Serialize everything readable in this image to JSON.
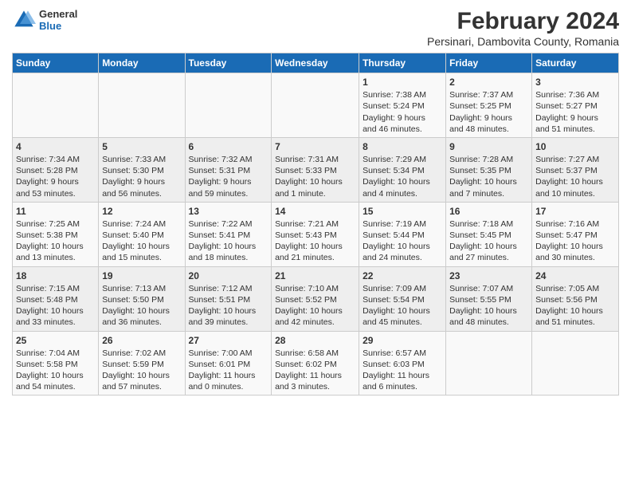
{
  "header": {
    "logo_general": "General",
    "logo_blue": "Blue",
    "month_year": "February 2024",
    "location": "Persinari, Dambovita County, Romania"
  },
  "days_of_week": [
    "Sunday",
    "Monday",
    "Tuesday",
    "Wednesday",
    "Thursday",
    "Friday",
    "Saturday"
  ],
  "weeks": [
    [
      {
        "day": "",
        "info": ""
      },
      {
        "day": "",
        "info": ""
      },
      {
        "day": "",
        "info": ""
      },
      {
        "day": "",
        "info": ""
      },
      {
        "day": "1",
        "info": "Sunrise: 7:38 AM\nSunset: 5:24 PM\nDaylight: 9 hours\nand 46 minutes."
      },
      {
        "day": "2",
        "info": "Sunrise: 7:37 AM\nSunset: 5:25 PM\nDaylight: 9 hours\nand 48 minutes."
      },
      {
        "day": "3",
        "info": "Sunrise: 7:36 AM\nSunset: 5:27 PM\nDaylight: 9 hours\nand 51 minutes."
      }
    ],
    [
      {
        "day": "4",
        "info": "Sunrise: 7:34 AM\nSunset: 5:28 PM\nDaylight: 9 hours\nand 53 minutes."
      },
      {
        "day": "5",
        "info": "Sunrise: 7:33 AM\nSunset: 5:30 PM\nDaylight: 9 hours\nand 56 minutes."
      },
      {
        "day": "6",
        "info": "Sunrise: 7:32 AM\nSunset: 5:31 PM\nDaylight: 9 hours\nand 59 minutes."
      },
      {
        "day": "7",
        "info": "Sunrise: 7:31 AM\nSunset: 5:33 PM\nDaylight: 10 hours\nand 1 minute."
      },
      {
        "day": "8",
        "info": "Sunrise: 7:29 AM\nSunset: 5:34 PM\nDaylight: 10 hours\nand 4 minutes."
      },
      {
        "day": "9",
        "info": "Sunrise: 7:28 AM\nSunset: 5:35 PM\nDaylight: 10 hours\nand 7 minutes."
      },
      {
        "day": "10",
        "info": "Sunrise: 7:27 AM\nSunset: 5:37 PM\nDaylight: 10 hours\nand 10 minutes."
      }
    ],
    [
      {
        "day": "11",
        "info": "Sunrise: 7:25 AM\nSunset: 5:38 PM\nDaylight: 10 hours\nand 13 minutes."
      },
      {
        "day": "12",
        "info": "Sunrise: 7:24 AM\nSunset: 5:40 PM\nDaylight: 10 hours\nand 15 minutes."
      },
      {
        "day": "13",
        "info": "Sunrise: 7:22 AM\nSunset: 5:41 PM\nDaylight: 10 hours\nand 18 minutes."
      },
      {
        "day": "14",
        "info": "Sunrise: 7:21 AM\nSunset: 5:43 PM\nDaylight: 10 hours\nand 21 minutes."
      },
      {
        "day": "15",
        "info": "Sunrise: 7:19 AM\nSunset: 5:44 PM\nDaylight: 10 hours\nand 24 minutes."
      },
      {
        "day": "16",
        "info": "Sunrise: 7:18 AM\nSunset: 5:45 PM\nDaylight: 10 hours\nand 27 minutes."
      },
      {
        "day": "17",
        "info": "Sunrise: 7:16 AM\nSunset: 5:47 PM\nDaylight: 10 hours\nand 30 minutes."
      }
    ],
    [
      {
        "day": "18",
        "info": "Sunrise: 7:15 AM\nSunset: 5:48 PM\nDaylight: 10 hours\nand 33 minutes."
      },
      {
        "day": "19",
        "info": "Sunrise: 7:13 AM\nSunset: 5:50 PM\nDaylight: 10 hours\nand 36 minutes."
      },
      {
        "day": "20",
        "info": "Sunrise: 7:12 AM\nSunset: 5:51 PM\nDaylight: 10 hours\nand 39 minutes."
      },
      {
        "day": "21",
        "info": "Sunrise: 7:10 AM\nSunset: 5:52 PM\nDaylight: 10 hours\nand 42 minutes."
      },
      {
        "day": "22",
        "info": "Sunrise: 7:09 AM\nSunset: 5:54 PM\nDaylight: 10 hours\nand 45 minutes."
      },
      {
        "day": "23",
        "info": "Sunrise: 7:07 AM\nSunset: 5:55 PM\nDaylight: 10 hours\nand 48 minutes."
      },
      {
        "day": "24",
        "info": "Sunrise: 7:05 AM\nSunset: 5:56 PM\nDaylight: 10 hours\nand 51 minutes."
      }
    ],
    [
      {
        "day": "25",
        "info": "Sunrise: 7:04 AM\nSunset: 5:58 PM\nDaylight: 10 hours\nand 54 minutes."
      },
      {
        "day": "26",
        "info": "Sunrise: 7:02 AM\nSunset: 5:59 PM\nDaylight: 10 hours\nand 57 minutes."
      },
      {
        "day": "27",
        "info": "Sunrise: 7:00 AM\nSunset: 6:01 PM\nDaylight: 11 hours\nand 0 minutes."
      },
      {
        "day": "28",
        "info": "Sunrise: 6:58 AM\nSunset: 6:02 PM\nDaylight: 11 hours\nand 3 minutes."
      },
      {
        "day": "29",
        "info": "Sunrise: 6:57 AM\nSunset: 6:03 PM\nDaylight: 11 hours\nand 6 minutes."
      },
      {
        "day": "",
        "info": ""
      },
      {
        "day": "",
        "info": ""
      }
    ]
  ]
}
